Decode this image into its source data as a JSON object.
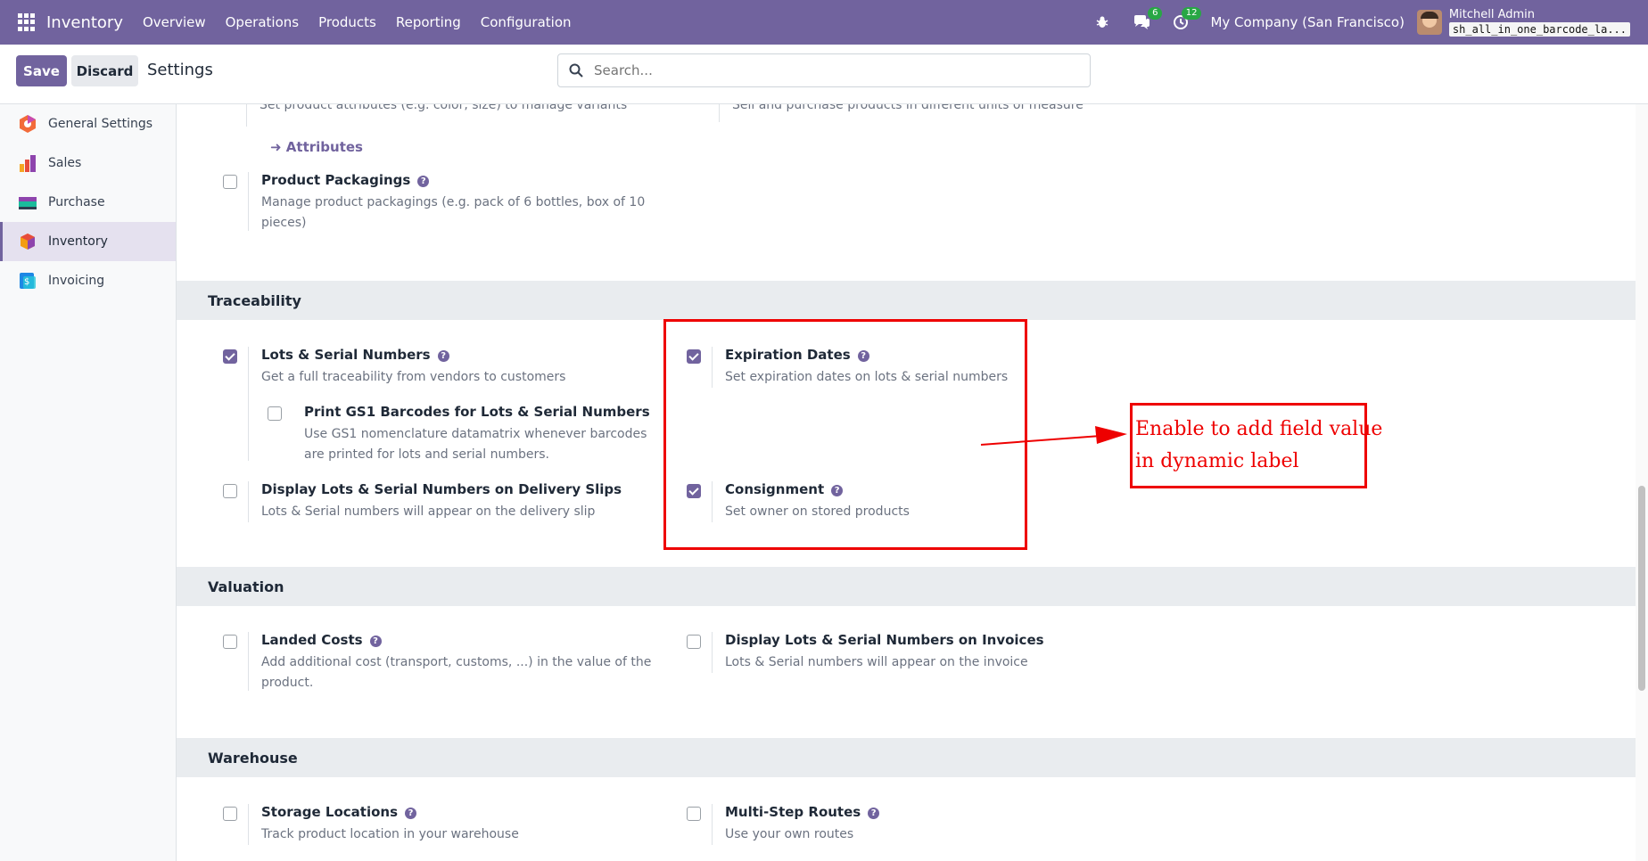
{
  "topnav": {
    "app_name": "Inventory",
    "menu": [
      "Overview",
      "Operations",
      "Products",
      "Reporting",
      "Configuration"
    ],
    "messages_badge": "6",
    "activities_badge": "12",
    "company": "My Company (San Francisco)",
    "user_name": "Mitchell Admin",
    "database": "sh_all_in_one_barcode_la..."
  },
  "controlbar": {
    "save_label": "Save",
    "discard_label": "Discard",
    "title": "Settings",
    "search_placeholder": "Search..."
  },
  "sidebar": {
    "items": [
      {
        "label": "General Settings",
        "icon": "general-settings-icon"
      },
      {
        "label": "Sales",
        "icon": "sales-icon"
      },
      {
        "label": "Purchase",
        "icon": "purchase-icon"
      },
      {
        "label": "Inventory",
        "icon": "inventory-icon",
        "active": true
      },
      {
        "label": "Invoicing",
        "icon": "invoicing-icon"
      }
    ]
  },
  "products": {
    "variants_desc": "Set product attributes (e.g. color, size) to manage variants",
    "uom_desc": "Sell and purchase products in different units of measure",
    "attributes_link": "Attributes",
    "packagings_title": "Product Packagings",
    "packagings_desc": "Manage product packagings (e.g. pack of 6 bottles, box of 10 pieces)",
    "packagings_checked": false
  },
  "traceability": {
    "heading": "Traceability",
    "lots_title": "Lots & Serial Numbers",
    "lots_desc": "Get a full traceability from vendors to customers",
    "lots_checked": true,
    "gs1_title": "Print GS1 Barcodes for Lots & Serial Numbers",
    "gs1_desc": "Use GS1 nomenclature datamatrix whenever barcodes are printed for lots and serial numbers.",
    "gs1_checked": false,
    "delivery_title": "Display Lots & Serial Numbers on Delivery Slips",
    "delivery_desc": "Lots & Serial numbers will appear on the delivery slip",
    "delivery_checked": false,
    "expiry_title": "Expiration Dates",
    "expiry_desc": "Set expiration dates on lots & serial numbers",
    "expiry_checked": true,
    "consign_title": "Consignment",
    "consign_desc": "Set owner on stored products",
    "consign_checked": true
  },
  "valuation": {
    "heading": "Valuation",
    "landed_title": "Landed Costs",
    "landed_desc": "Add additional cost (transport, customs, ...) in the value of the product.",
    "landed_checked": false,
    "invoice_title": "Display Lots & Serial Numbers on Invoices",
    "invoice_desc": "Lots & Serial numbers will appear on the invoice",
    "invoice_checked": false
  },
  "warehouse": {
    "heading": "Warehouse",
    "storage_title": "Storage Locations",
    "storage_desc": "Track product location in your warehouse",
    "storage_checked": false,
    "routes_title": "Multi-Step Routes",
    "routes_desc": "Use your own routes",
    "routes_checked": false
  },
  "annotation": {
    "text_line1": "Enable to add field value",
    "text_line2": "in dynamic label",
    "color": "#ee0000"
  },
  "colors": {
    "brand": "#71639e",
    "section_bg": "#e9ecef"
  }
}
